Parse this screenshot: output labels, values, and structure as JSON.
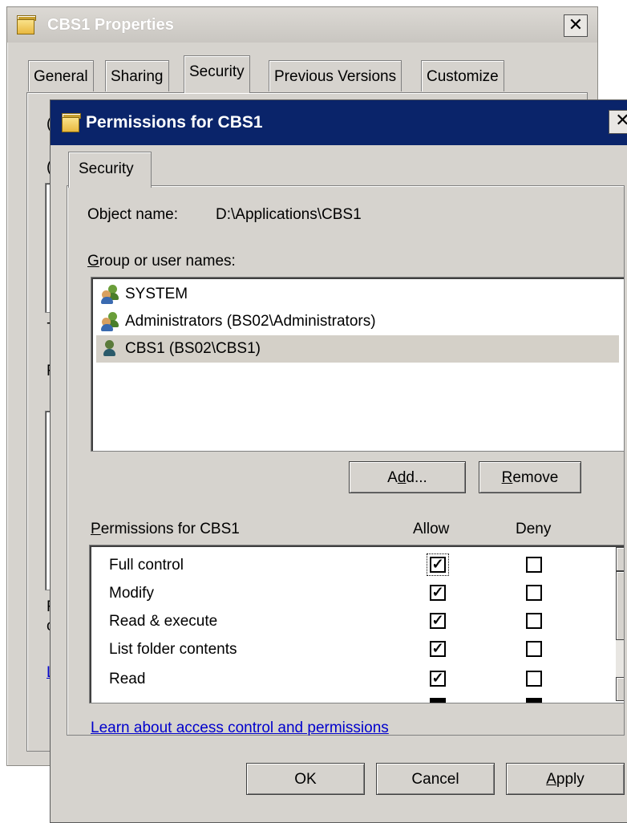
{
  "back_window": {
    "title": "CBS1 Properties",
    "close_glyph": "✕",
    "tabs": [
      {
        "label": "General"
      },
      {
        "label": "Sharing"
      },
      {
        "label": "Security"
      },
      {
        "label": "Previous Versions"
      },
      {
        "label": "Customize"
      }
    ],
    "active_tab": "Security",
    "partial_text": [
      "(",
      "(",
      "-",
      "F",
      "F",
      "c",
      "L"
    ]
  },
  "dialog": {
    "title": "Permissions for CBS1",
    "close_glyph": "✕",
    "tab": "Security",
    "object_name_label": "Object name:",
    "object_name_value": "D:\\Applications\\CBS1",
    "group_label_accel": "G",
    "group_label_rest": "roup or user names:",
    "users": [
      {
        "name": "SYSTEM",
        "icon": "user-group-icon"
      },
      {
        "name": "Administrators (BS02\\Administrators)",
        "icon": "user-group-icon"
      },
      {
        "name": "CBS1 (BS02\\CBS1)",
        "icon": "user-icon",
        "selected": true
      }
    ],
    "add_button": {
      "pre": "A",
      "accel": "d",
      "post": "d..."
    },
    "remove_button": {
      "accel": "R",
      "post": "emove"
    },
    "permissions_label": {
      "accel": "P",
      "post": "ermissions for CBS1"
    },
    "allow_header": "Allow",
    "deny_header": "Deny",
    "permissions": [
      {
        "name": "Full control",
        "allow": true,
        "deny": false
      },
      {
        "name": "Modify",
        "allow": true,
        "deny": false
      },
      {
        "name": "Read & execute",
        "allow": true,
        "deny": false
      },
      {
        "name": "List folder contents",
        "allow": true,
        "deny": false
      },
      {
        "name": "Read",
        "allow": true,
        "deny": false
      }
    ],
    "check_glyph": "✓",
    "scroll_up_glyph": "▲",
    "scroll_down_glyph": "▼",
    "learn_link": "Learn about access control and permissions",
    "ok_button": "OK",
    "cancel_button": "Cancel",
    "apply_button": {
      "accel": "A",
      "post": "pply"
    }
  },
  "colors": {
    "dialog_face": "#d6d3ce",
    "active_title": "#0a246a",
    "link": "#0000cc"
  }
}
